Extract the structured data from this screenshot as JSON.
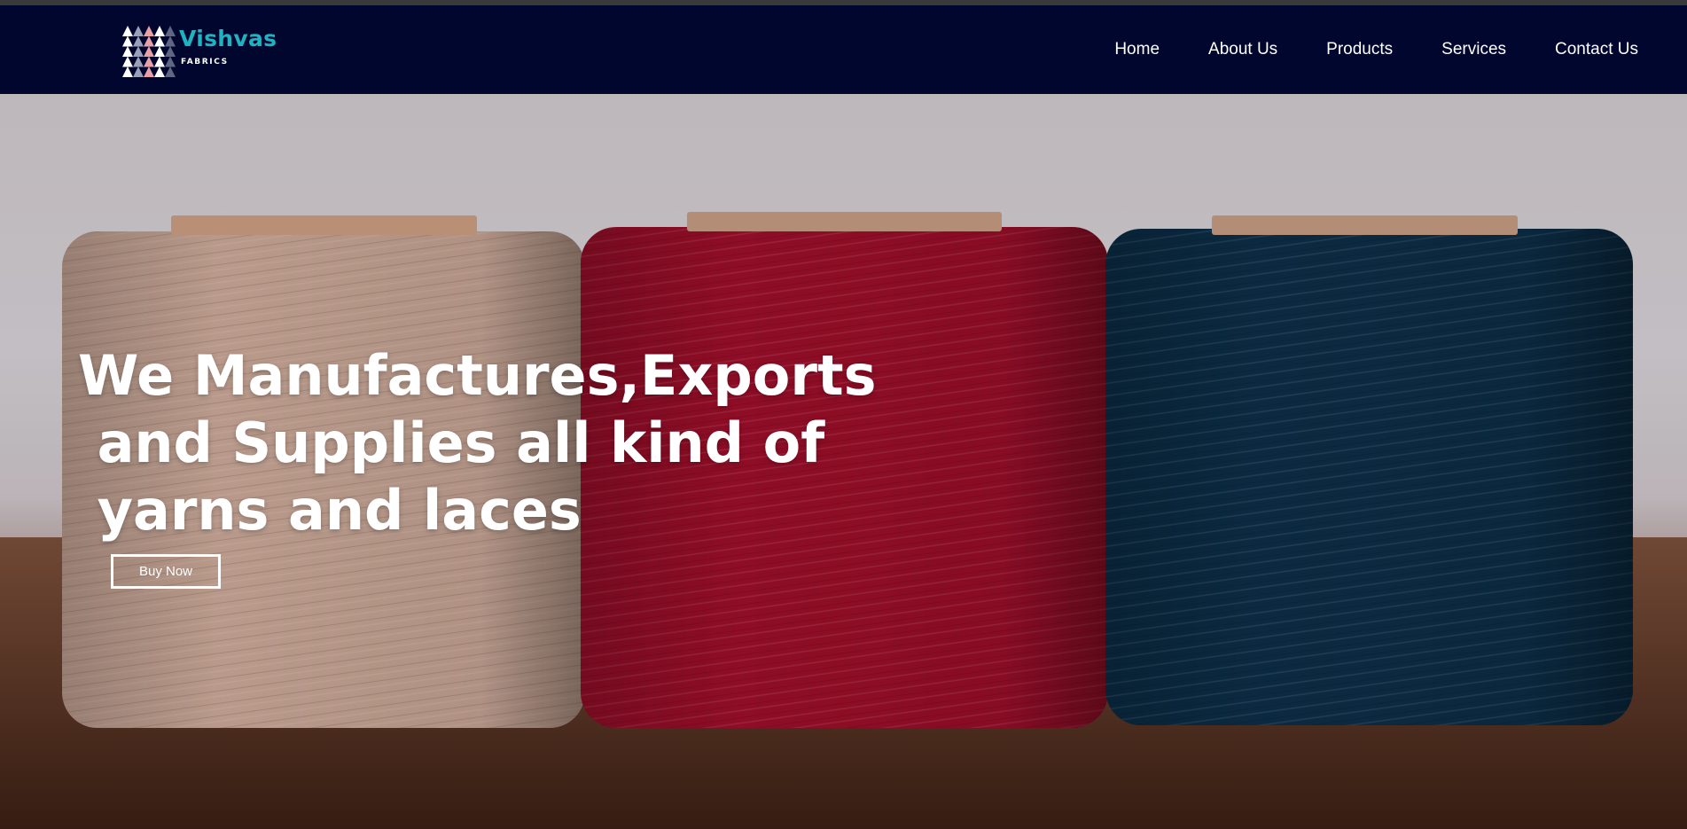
{
  "brand": {
    "name": "Vishvas",
    "tagline": "FABRICS",
    "accent_color": "#1fb3c1",
    "logo_icon": "triangle-pattern-logo-icon"
  },
  "nav": {
    "background": "#00062e",
    "items": [
      {
        "label": "Home"
      },
      {
        "label": "About Us"
      },
      {
        "label": "Products"
      },
      {
        "label": "Services"
      },
      {
        "label": "Contact Us"
      }
    ]
  },
  "hero": {
    "title": "We Manufactures,Exports\n and Supplies all kind of\n yarns and laces",
    "button_label": "Buy Now",
    "image": "thread-spools-photo",
    "spool_colors": [
      "#c9a797",
      "#9c0f2a",
      "#0c2e47"
    ]
  }
}
